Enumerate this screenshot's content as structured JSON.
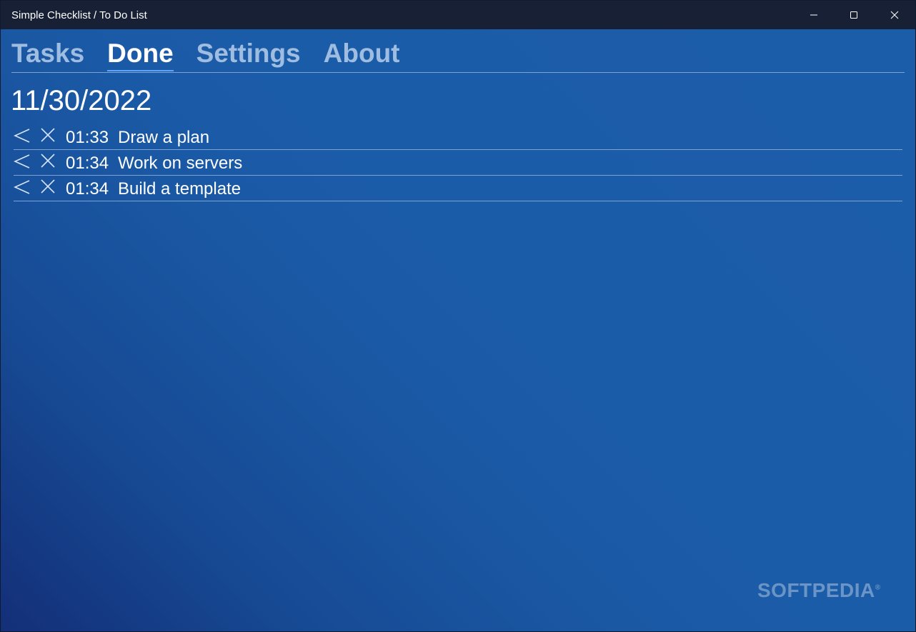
{
  "window": {
    "title": "Simple Checklist / To Do List"
  },
  "tabs": [
    {
      "label": "Tasks",
      "active": false
    },
    {
      "label": "Done",
      "active": true
    },
    {
      "label": "Settings",
      "active": false
    },
    {
      "label": "About",
      "active": false
    }
  ],
  "done": {
    "date": "11/30/2022",
    "items": [
      {
        "time": "01:33",
        "task": "Draw a plan"
      },
      {
        "time": "01:34",
        "task": "Work on servers"
      },
      {
        "time": "01:34",
        "task": "Build a template"
      }
    ]
  },
  "watermark": {
    "text": "SOFTPEDIA",
    "mark": "®"
  },
  "icons": {
    "minimize": "minimize-icon",
    "maximize": "maximize-icon",
    "close": "close-icon",
    "restore_task": "chevron-left-icon",
    "delete_task": "x-icon"
  },
  "colors": {
    "titlebar": "#172035",
    "background": "#1b5ca8",
    "inactive_tab": "#9fbde0",
    "active_underline": "#5ea4ff"
  }
}
